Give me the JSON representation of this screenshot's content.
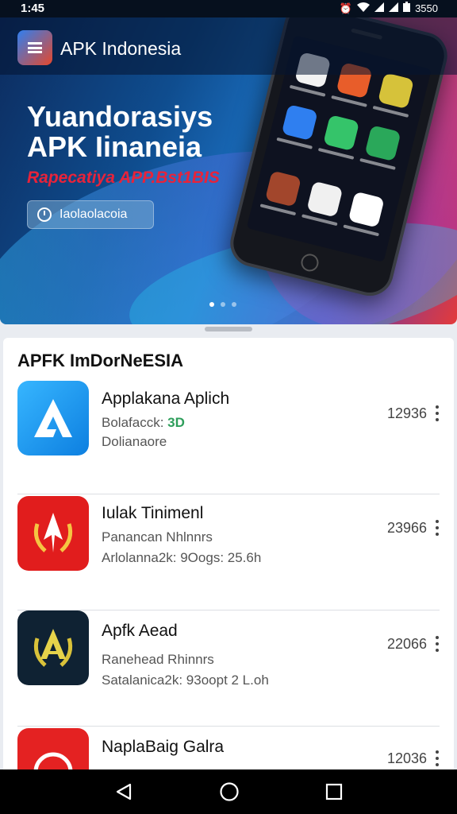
{
  "status_bar": {
    "time": "1:45",
    "icons": [
      "alarm-icon",
      "wifi-icon",
      "signal-icon",
      "signal-icon",
      "battery-icon"
    ],
    "battery_text": "3550"
  },
  "header": {
    "title": "APK Indonesia"
  },
  "hero": {
    "title_line1": "Yuandorasiys",
    "title_line2": "APK Iinaneia",
    "subtitle": "Rapecatiya APP.Bst1BIS",
    "button_label": "Iaolaolacoia",
    "carousel_dots": 3,
    "active_dot": 0
  },
  "list": {
    "title": "APFK ImDorNeESIA",
    "apps": [
      {
        "name": "Applakana Aplich",
        "line1": "Bolafacck:",
        "line1_badge": "3D",
        "line2": "Dolianaore",
        "count": "12936",
        "icon": "blue-a-app-icon",
        "icon_color": "#1e9bf0"
      },
      {
        "name": "Iulak Tinimenl",
        "line1": "Panancan Nhlnnrs",
        "line2": "Arlolanna2k: 9Oogs: 25.6h",
        "count": "23966",
        "icon": "red-emblem-app-icon",
        "icon_color": "#e11d1d"
      },
      {
        "name": "Apfk Aead",
        "line1": "Ranehead Rhinnrs",
        "line2": "Satalanica2k: 93oopt 2 L.oh",
        "count": "22066",
        "icon": "gold-emblem-app-icon",
        "icon_color": "#0f2233"
      },
      {
        "name": "NaplaBaig Galra",
        "line1": "",
        "line2": "",
        "count": "12036",
        "icon": "red-circle-app-icon",
        "icon_color": "#e42222"
      }
    ]
  },
  "nav": {
    "icons": [
      "back-icon",
      "home-icon",
      "recents-icon"
    ]
  }
}
